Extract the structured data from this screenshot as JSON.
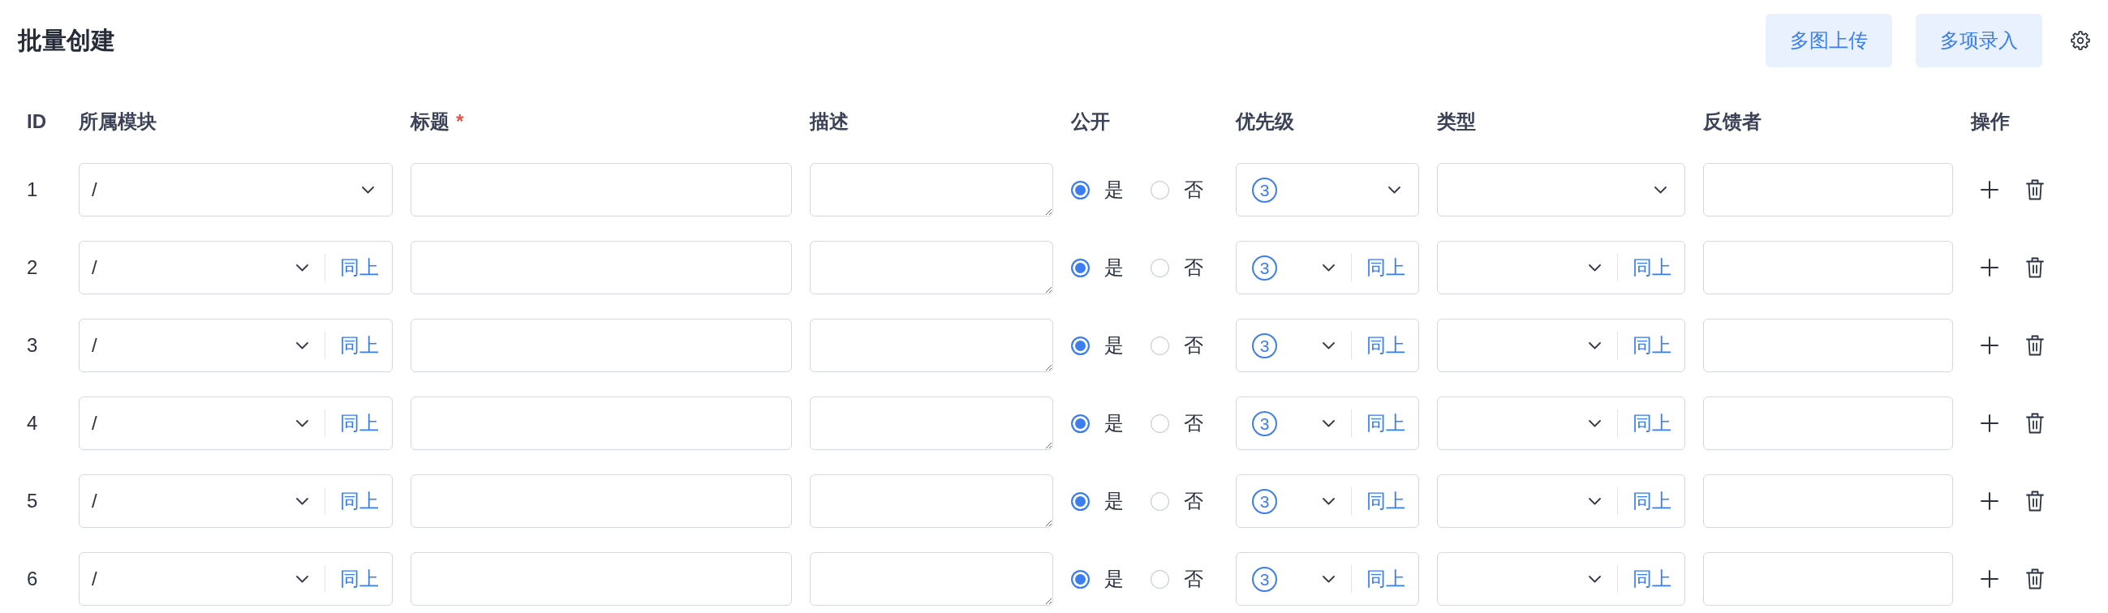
{
  "page": {
    "title": "批量创建"
  },
  "toolbar": {
    "buttons": [
      "多图上传",
      "多项录入"
    ]
  },
  "table": {
    "columns": [
      {
        "label": "ID"
      },
      {
        "label": "所属模块"
      },
      {
        "label": "标题",
        "required_mark": "*"
      },
      {
        "label": "描述"
      },
      {
        "label": "公开"
      },
      {
        "label": "优先级"
      },
      {
        "label": "类型"
      },
      {
        "label": "反馈者"
      },
      {
        "label": "操作"
      }
    ],
    "rows": [
      {
        "cells": [
          {
            "kind": "id",
            "text": "1"
          },
          {
            "kind": "select",
            "value": "/"
          },
          {
            "kind": "input"
          },
          {
            "kind": "textarea"
          },
          {
            "kind": "radio",
            "options": [
              {
                "label": "是",
                "selected": true
              },
              {
                "label": "否",
                "selected": false
              }
            ]
          },
          {
            "kind": "priority",
            "value": "3"
          },
          {
            "kind": "select"
          },
          {
            "kind": "input"
          },
          {
            "kind": "actions"
          }
        ]
      },
      {
        "cells": [
          {
            "kind": "id",
            "text": "2"
          },
          {
            "kind": "select",
            "value": "/",
            "copy_label": "同上"
          },
          {
            "kind": "input"
          },
          {
            "kind": "textarea"
          },
          {
            "kind": "radio",
            "options": [
              {
                "label": "是",
                "selected": true
              },
              {
                "label": "否",
                "selected": false
              }
            ]
          },
          {
            "kind": "priority",
            "value": "3",
            "copy_label": "同上"
          },
          {
            "kind": "select",
            "copy_label": "同上"
          },
          {
            "kind": "input"
          },
          {
            "kind": "actions"
          }
        ]
      },
      {
        "cells": [
          {
            "kind": "id",
            "text": "3"
          },
          {
            "kind": "select",
            "value": "/",
            "copy_label": "同上"
          },
          {
            "kind": "input"
          },
          {
            "kind": "textarea"
          },
          {
            "kind": "radio",
            "options": [
              {
                "label": "是",
                "selected": true
              },
              {
                "label": "否",
                "selected": false
              }
            ]
          },
          {
            "kind": "priority",
            "value": "3",
            "copy_label": "同上"
          },
          {
            "kind": "select",
            "copy_label": "同上"
          },
          {
            "kind": "input"
          },
          {
            "kind": "actions"
          }
        ]
      },
      {
        "cells": [
          {
            "kind": "id",
            "text": "4"
          },
          {
            "kind": "select",
            "value": "/",
            "copy_label": "同上"
          },
          {
            "kind": "input"
          },
          {
            "kind": "textarea"
          },
          {
            "kind": "radio",
            "options": [
              {
                "label": "是",
                "selected": true
              },
              {
                "label": "否",
                "selected": false
              }
            ]
          },
          {
            "kind": "priority",
            "value": "3",
            "copy_label": "同上"
          },
          {
            "kind": "select",
            "copy_label": "同上"
          },
          {
            "kind": "input"
          },
          {
            "kind": "actions"
          }
        ]
      },
      {
        "cells": [
          {
            "kind": "id",
            "text": "5"
          },
          {
            "kind": "select",
            "value": "/",
            "copy_label": "同上"
          },
          {
            "kind": "input"
          },
          {
            "kind": "textarea"
          },
          {
            "kind": "radio",
            "options": [
              {
                "label": "是",
                "selected": true
              },
              {
                "label": "否",
                "selected": false
              }
            ]
          },
          {
            "kind": "priority",
            "value": "3",
            "copy_label": "同上"
          },
          {
            "kind": "select",
            "copy_label": "同上"
          },
          {
            "kind": "input"
          },
          {
            "kind": "actions"
          }
        ]
      },
      {
        "cells": [
          {
            "kind": "id",
            "text": "6"
          },
          {
            "kind": "select",
            "value": "/",
            "copy_label": "同上"
          },
          {
            "kind": "input"
          },
          {
            "kind": "textarea"
          },
          {
            "kind": "radio",
            "options": [
              {
                "label": "是",
                "selected": true
              },
              {
                "label": "否",
                "selected": false
              }
            ]
          },
          {
            "kind": "priority",
            "value": "3",
            "copy_label": "同上"
          },
          {
            "kind": "select",
            "copy_label": "同上"
          },
          {
            "kind": "input"
          },
          {
            "kind": "actions"
          }
        ]
      }
    ]
  }
}
